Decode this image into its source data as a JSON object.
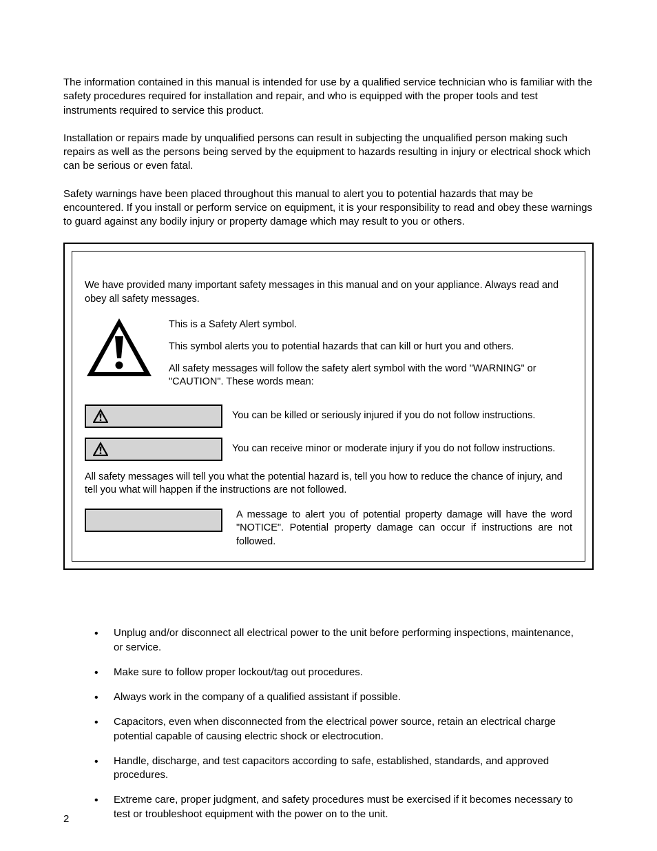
{
  "intro": {
    "p1": "The information contained in this manual is intended for use by a qualified service technician who is familiar with the safety procedures required for installation and repair, and who is equipped with the proper tools and test instruments required to service this product.",
    "p2": "Installation or repairs made by unqualified persons can result in subjecting the unqualified person making such repairs as well as the persons being served by the equipment to hazards resulting in injury or electrical shock which can be serious or even fatal.",
    "p3": "Safety warnings have been placed throughout this manual to alert you to potential hazards that may be encountered.  If you install or perform service on equipment, it is your responsibility to read and obey these warnings to guard against any bodily injury or property damage which may result to you or others."
  },
  "notice": {
    "intro": "We have provided many important safety messages in this manual and on your appliance. Always read and obey all safety messages.",
    "alert": {
      "l1": "This is a Safety Alert symbol.",
      "l2": "This symbol alerts you to potential hazards that can kill or hurt you and others.",
      "l3": "All safety messages will follow the safety alert symbol with the word \"WARNING\" or \"CAUTION\". These words mean:"
    },
    "warning_text": "You can be killed or seriously injured if you do not follow instructions.",
    "caution_text": "You can receive minor or moderate injury if you do not follow instructions.",
    "followup": "All safety messages will tell you what the potential hazard is, tell you how to reduce the chance of injury, and tell you what will happen if the instructions are not followed.",
    "notice_text": "A message to alert you of potential property damage will have the word \"NOTICE\". Potential property damage can occur if instructions are not followed."
  },
  "bullets": [
    "Unplug and/or disconnect all electrical power to the unit before performing inspections, maintenance, or service.",
    "Make sure to follow proper lockout/tag out procedures.",
    "Always work in the company of a qualified assistant if possible.",
    "Capacitors, even when disconnected from the electrical power source, retain an electrical charge potential capable of causing electric shock or electrocution.",
    "Handle, discharge, and test capacitors according to safe, established, standards, and approved procedures.",
    "Extreme care, proper judgment, and safety procedures must be exercised if it becomes necessary to test or troubleshoot equipment with the power on to the unit."
  ],
  "page_number": "2"
}
